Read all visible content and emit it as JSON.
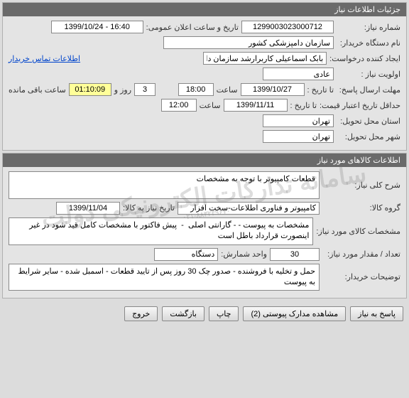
{
  "watermark": {
    "line1": "سامانه تدارکات الکترونیکی دولت",
    "line2": "۰۲۱-۸۸۳۲۴۹۶۷۰"
  },
  "section1": {
    "title": "جزئیات اطلاعات نیاز",
    "need_no_label": "شماره نیاز:",
    "need_no": "1299003023000712",
    "announce_label": "تاریخ و ساعت اعلان عمومی:",
    "announce_val": "1399/10/24 - 16:40",
    "org_label": "نام دستگاه خریدار:",
    "org_val": "سازمان دامپزشکی کشور",
    "creator_label": "ایجاد کننده درخواست:",
    "creator_val": "بابک اسماعیلی کاربرارشد سازمان دامپزشکی کشور",
    "contact_link": "اطلاعات تماس خریدار",
    "priority_label": "اولویت نیاز :",
    "priority_val": "عادی",
    "deadline_label": "مهلت ارسال پاسخ:",
    "until_label": "تا تاریخ :",
    "deadline_date": "1399/10/27",
    "time_label": "ساعت",
    "deadline_time": "18:00",
    "days_val": "3",
    "days_label": "روز و",
    "countdown": "01:10:09",
    "remain_label": "ساعت باقی مانده",
    "min_validity_label": "حداقل تاریخ اعتبار قیمت:",
    "min_validity_date": "1399/11/11",
    "min_validity_time": "12:00",
    "province_label": "استان محل تحویل:",
    "province_val": "تهران",
    "city_label": "شهر محل تحویل:",
    "city_val": "تهران"
  },
  "section2": {
    "title": "اطلاعات کالاهای مورد نیاز",
    "desc_label": "شرح کلی نیاز:",
    "desc_val": "قطعات کامپیوتر با توجه به مشخصات",
    "group_label": "گروه کالا:",
    "group_val": "کامپیوتر و فناوری اطلاعات-سخت افزار",
    "need_date_label": "تاریخ نیاز به کالا:",
    "need_date_val": "1399/11/04",
    "spec_label": "مشخصات کالای مورد نیاز:",
    "spec_val": "مشخصات به پیوست - - گارانتی اصلی  -  پیش فاکتور با مشخصات کامل قید شود در غیر اینصورت قرارداد باطل است",
    "qty_label": "تعداد / مقدار مورد نیاز:",
    "qty_val": "30",
    "unit_label": "واحد شمارش:",
    "unit_val": "دستگاه",
    "buyer_notes_label": "توضیحات خریدار:",
    "buyer_notes_val": "حمل و تخلیه با فروشنده - صدور چک 30 روز پس از تایید قطعات - اسمبل شده - سایر شرایط به پیوست"
  },
  "buttons": {
    "respond": "پاسخ به نیاز",
    "attachments": "مشاهده مدارک پیوستی (2)",
    "print": "چاپ",
    "back": "بازگشت",
    "exit": "خروج"
  }
}
